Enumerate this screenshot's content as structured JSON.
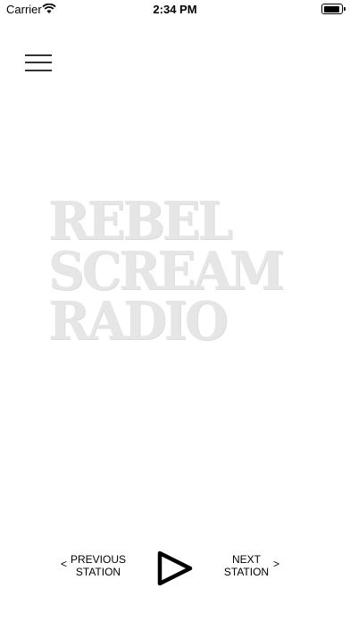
{
  "status_bar": {
    "carrier": "Carrier",
    "time": "2:34 PM"
  },
  "logo": {
    "lines": [
      "REBEL",
      "SCREAM",
      "RADIO"
    ]
  },
  "controls": {
    "previous_line1": "PREVIOUS",
    "previous_line2": "STATION",
    "next_line1": "NEXT",
    "next_line2": "STATION",
    "prev_chevron": "<",
    "next_chevron": ">"
  },
  "icons": {
    "wifi": "wifi-icon",
    "battery": "battery-icon",
    "menu": "hamburger-menu-icon",
    "play": "play-icon"
  }
}
